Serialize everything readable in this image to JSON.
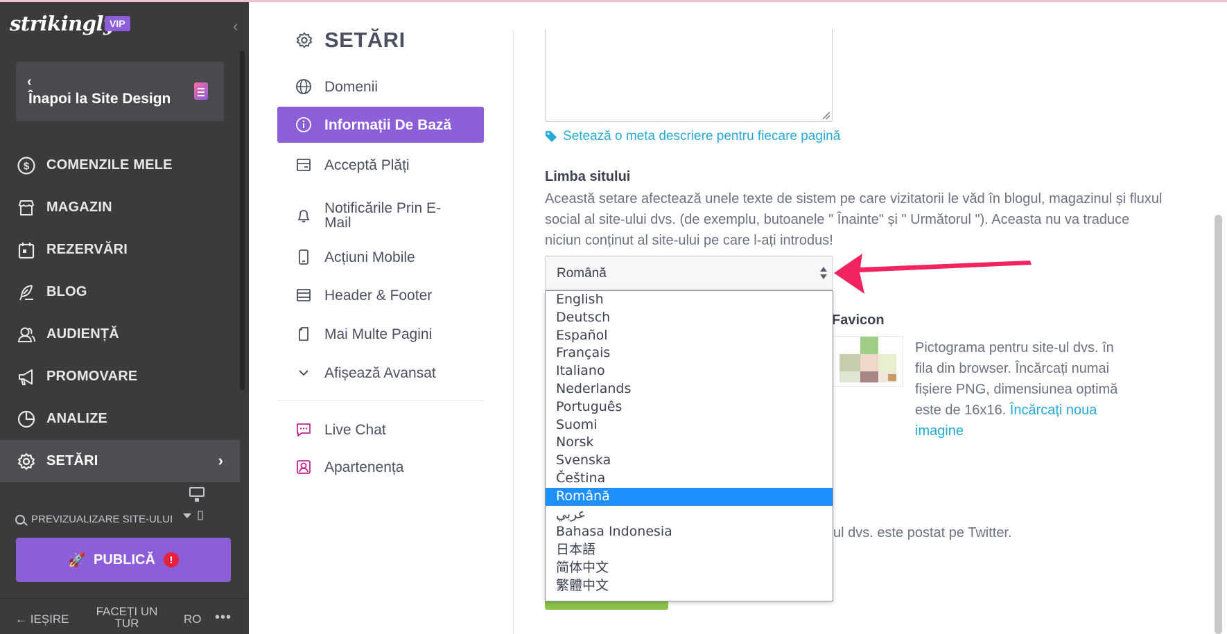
{
  "app": {
    "logo_text": "strikingly",
    "vip_badge": "VIP"
  },
  "sidebar": {
    "back_label": "Înapoi la Site Design",
    "items": [
      {
        "label": "COMENZILE MELE",
        "icon": "dollar-icon"
      },
      {
        "label": "MAGAZIN",
        "icon": "store-icon"
      },
      {
        "label": "REZERVĂRI",
        "icon": "calendar-icon"
      },
      {
        "label": "BLOG",
        "icon": "feather-icon"
      },
      {
        "label": "AUDIENȚĂ",
        "icon": "people-icon"
      },
      {
        "label": "PROMOVARE",
        "icon": "megaphone-icon"
      },
      {
        "label": "ANALIZE",
        "icon": "pie-chart-icon"
      },
      {
        "label": "SETĂRI",
        "icon": "gear-icon",
        "active": true
      }
    ],
    "preview_label": "PREVIZUALIZARE SITE-ULUI",
    "publish_label": "PUBLICĂ",
    "publish_warning": "!",
    "footer": {
      "exit": "IEȘIRE",
      "tour": "FACEȚI UN TUR",
      "lang": "RO",
      "more": "•••"
    }
  },
  "settings_menu": {
    "title": "SETĂRI",
    "items": [
      {
        "label": "Domenii",
        "icon": "globe-icon"
      },
      {
        "label": "Informații De Bază",
        "icon": "info-icon",
        "active": true
      },
      {
        "label": "Acceptă Plăți",
        "icon": "wallet-icon"
      },
      {
        "label": "Notificările Prin E-Mail",
        "icon": "bell-icon"
      },
      {
        "label": "Acțiuni Mobile",
        "icon": "mobile-icon"
      },
      {
        "label": "Header & Footer",
        "icon": "layout-icon"
      },
      {
        "label": "Mai Multe Pagini",
        "icon": "pages-icon"
      },
      {
        "label": "Afișează Avansat",
        "icon": "chevron-down-icon"
      },
      {
        "label": "Live Chat",
        "icon": "chat-icon"
      },
      {
        "label": "Apartenența",
        "icon": "member-icon"
      }
    ]
  },
  "main": {
    "meta_link": "Setează o meta descriere pentru fiecare pagină",
    "language_section": {
      "title": "Limba sitului",
      "description": "Această setare afectează unele texte de sistem pe care vizitatorii le văd în blogul, magazinul și fluxul social al site-ului dvs. (de exemplu, butoanele \" Înainte\" și \" Următorul \"). Aceasta nu va traduce niciun conținut al site-ului pe care l-ați introdus!",
      "selected": "Română",
      "options": [
        "English",
        "Deutsch",
        "Español",
        "Français",
        "Italiano",
        "Nederlands",
        "Português",
        "Suomi",
        "Norsk",
        "Svenska",
        "Čeština",
        "Română",
        "عربي",
        "Bahasa Indonesia",
        "日本語",
        "简体中文",
        "繁體中文"
      ]
    },
    "favicon": {
      "title": "Favicon",
      "description": "Pictograma pentru site-ul dvs. în fila din browser. Încărcați numai fișiere PNG, dimensiunea optimă este de 16x16.",
      "upload_link": "Încărcați noua imagine"
    },
    "twitter_text_fragment": "ul dvs. este postat pe Twitter."
  },
  "colors": {
    "accent": "#8c5ed8",
    "sidebar_bg": "#3b3b3e",
    "link": "#26a9d6",
    "selected_option": "#1e90ff",
    "annotation_arrow": "#f0245e"
  }
}
